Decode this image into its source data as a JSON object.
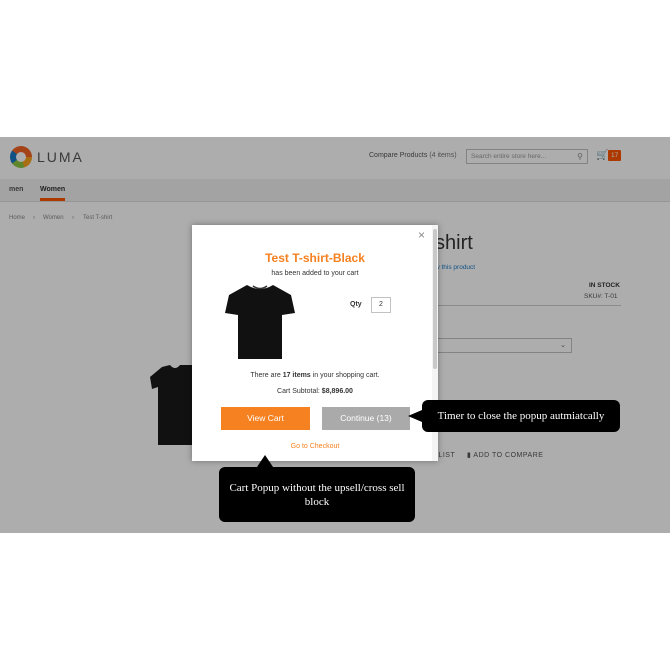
{
  "header": {
    "logo_text": "LUMA",
    "compare_label": "Compare Products",
    "compare_count": "(4 items)",
    "search_placeholder": "Search entire store here...",
    "cart_count": "17"
  },
  "nav": {
    "items": [
      "men",
      "Women"
    ]
  },
  "breadcrumb": [
    "Home",
    "Women",
    "Test T-shirt"
  ],
  "product": {
    "title_partial": "shirt",
    "review_link": "w this product",
    "stock": "IN STOCK",
    "sku": "SKU#:  T-01",
    "wishlist": "LIST",
    "compare": "ADD TO COMPARE"
  },
  "modal": {
    "title": "Test T-shirt-Black",
    "subtitle": "has been added to your cart",
    "qty_label": "Qty",
    "qty_value": "2",
    "items_prefix": "There are",
    "items_count": "17 items",
    "items_suffix": "in your shopping cart.",
    "subtotal_label": "Cart Subtotal:",
    "subtotal_value": "$8,896.00",
    "view_cart": "View Cart",
    "continue": "Continue (13)",
    "checkout": "Go to Checkout"
  },
  "callouts": {
    "timer": "Timer to close the popup autmiatcally",
    "popup": "Cart Popup without the upsell/cross sell block"
  },
  "colors": {
    "accent": "#f68120",
    "brand_orange": "#ff5501",
    "link": "#1979c3"
  }
}
